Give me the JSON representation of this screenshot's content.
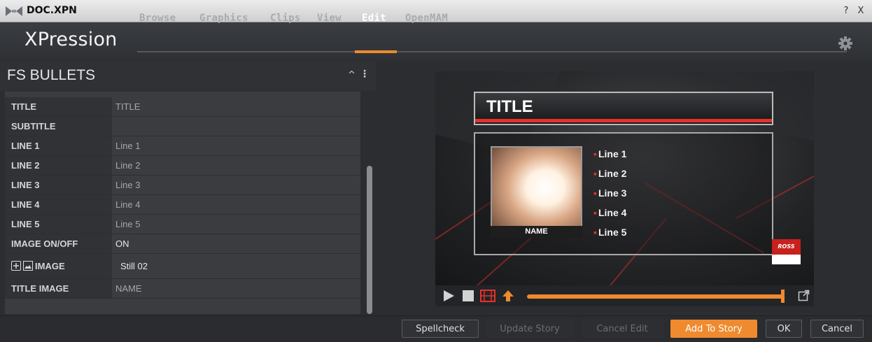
{
  "window": {
    "title": "DOC.XPN",
    "help_label": "?",
    "close_label": "X"
  },
  "header": {
    "logo": "XPression",
    "tabs": [
      {
        "label": "Browse",
        "active": false
      },
      {
        "label": "Graphics",
        "active": false
      },
      {
        "label": "Clips",
        "active": false
      },
      {
        "label": "View",
        "active": false
      },
      {
        "label": "Edit",
        "active": true
      },
      {
        "label": "OpenMAM",
        "active": false
      }
    ],
    "accent": "#ef8a2e"
  },
  "panel": {
    "title": "FS BULLETS",
    "collapse_icon": "^",
    "menu_icon": "⋮",
    "fields": [
      {
        "label": "TITLE",
        "value": "TITLE"
      },
      {
        "label": "SUBTITLE",
        "value": ""
      },
      {
        "label": "LINE 1",
        "value": "Line 1"
      },
      {
        "label": "LINE 2",
        "value": "Line 2"
      },
      {
        "label": "LINE 3",
        "value": "Line 3"
      },
      {
        "label": "LINE 4",
        "value": "Line 4"
      },
      {
        "label": "LINE 5",
        "value": "Line 5"
      },
      {
        "label": "IMAGE ON/OFF",
        "value": "ON"
      },
      {
        "label": "IMAGE",
        "value": "Still 02"
      },
      {
        "label": "TITLE IMAGE",
        "value": "NAME"
      }
    ]
  },
  "preview": {
    "title": "TITLE",
    "image_caption": "NAME",
    "lines": [
      "Line 1",
      "Line 2",
      "Line 3",
      "Line 4",
      "Line 5"
    ],
    "brand": "ROSS",
    "brand_color": "#c8201d",
    "highlight_color": "#e5322c"
  },
  "transport": {
    "icons": [
      "play-icon",
      "stop-icon",
      "film-icon",
      "upload-arrow-icon",
      "popout-icon"
    ]
  },
  "footer": {
    "spellcheck": "Spellcheck",
    "update_story": "Update Story",
    "cancel_edit": "Cancel Edit",
    "add_to_story": "Add To Story",
    "ok": "OK",
    "cancel": "Cancel"
  }
}
